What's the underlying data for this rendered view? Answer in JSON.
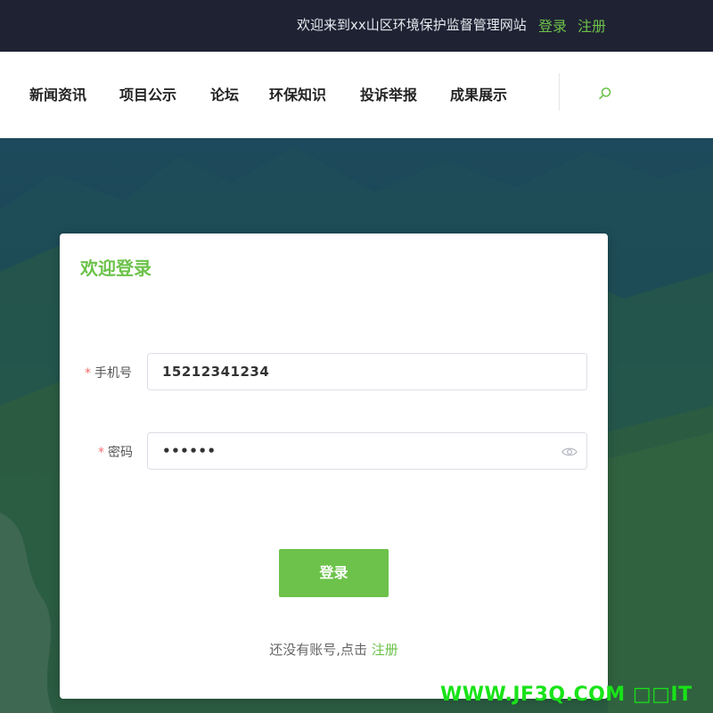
{
  "topbar": {
    "welcome_text": "欢迎来到xx山区环境保护监督管理网站",
    "login_link": "登录",
    "register_link": "注册"
  },
  "nav": {
    "items": [
      {
        "label": "新闻资讯"
      },
      {
        "label": "项目公示"
      },
      {
        "label": "论坛"
      },
      {
        "label": "环保知识"
      },
      {
        "label": "投诉举报"
      },
      {
        "label": "成果展示"
      }
    ],
    "search_icon": "search-icon"
  },
  "login_form": {
    "title": "欢迎登录",
    "required_mark": "*",
    "phone_label": "手机号",
    "phone_value": "15212341234",
    "password_label": "密码",
    "password_value": "••••••",
    "password_icon": "eye-icon",
    "submit_label": "登录",
    "register_prompt": "还没有账号,点击",
    "register_link": "注册"
  },
  "watermark": {
    "text": "WWW.JF3Q.COM □□IT"
  },
  "colors": {
    "accent": "#6cc24a",
    "topbar_bg": "#1f2233",
    "required": "#f56c6c"
  }
}
